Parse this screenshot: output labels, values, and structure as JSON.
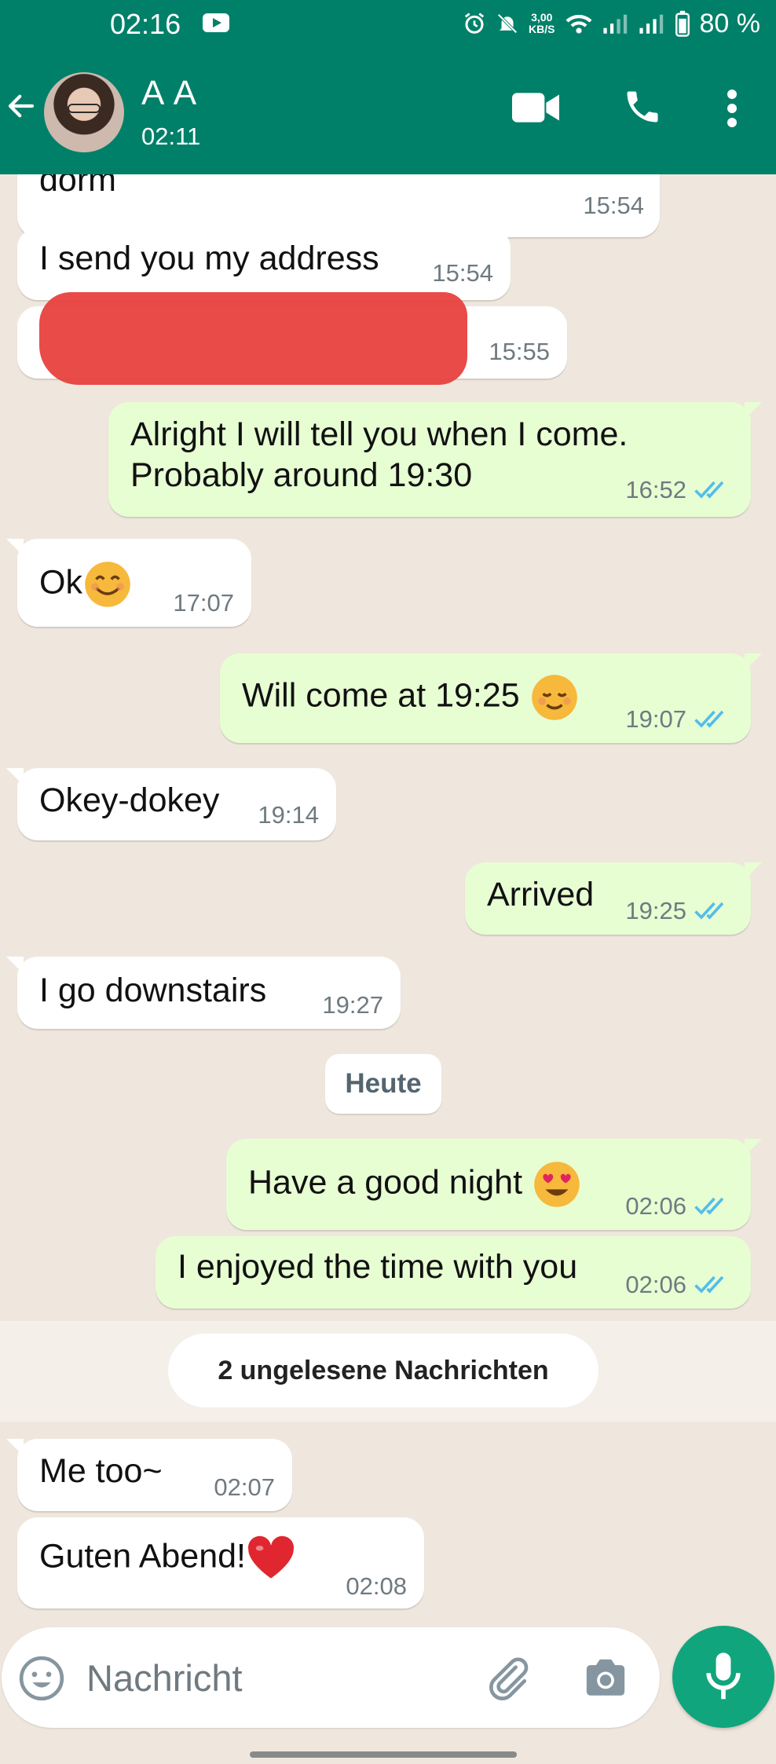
{
  "status_bar": {
    "time": "02:16",
    "net_speed_value": "3,00",
    "net_speed_unit": "KB/S",
    "battery": "80 %"
  },
  "header": {
    "contact_name": "A A",
    "subtitle": "02:11",
    "icons": [
      "back-arrow-icon",
      "video-call-icon",
      "voice-call-icon",
      "more-options-icon"
    ]
  },
  "messages": [
    {
      "dir": "in",
      "text": "dorm",
      "time": "15:54"
    },
    {
      "dir": "in",
      "text": "I send you my address",
      "time": "15:54"
    },
    {
      "dir": "in",
      "text": "",
      "time": "15:55"
    },
    {
      "dir": "out",
      "text_line1": "Alright I will tell you when I come.",
      "text_line2": "Probably around 19:30",
      "time": "16:52",
      "status": "read"
    },
    {
      "dir": "in",
      "text": "Ok",
      "emoji": "smiling-face-emoji",
      "time": "17:07"
    },
    {
      "dir": "out",
      "text": "Will come at 19:25",
      "emoji": "relieved-face-emoji",
      "time": "19:07",
      "status": "read"
    },
    {
      "dir": "in",
      "text": "Okey-dokey",
      "time": "19:14"
    },
    {
      "dir": "out",
      "text": "Arrived",
      "time": "19:25",
      "status": "read"
    },
    {
      "dir": "in",
      "text": "I go downstairs",
      "time": "19:27"
    },
    {
      "dir": "out",
      "text": "Have a good night",
      "emoji": "heart-eyes-emoji",
      "time": "02:06",
      "status": "read"
    },
    {
      "dir": "out",
      "text": "I enjoyed the time with you",
      "time": "02:06",
      "status": "read"
    },
    {
      "dir": "in",
      "text": "Me too~",
      "time": "02:07"
    },
    {
      "dir": "in",
      "text": "Guten Abend!",
      "emoji": "red-heart-emoji",
      "time": "02:08"
    }
  ],
  "date_separator": "Heute",
  "unread_banner": "2 ungelesene Nachrichten",
  "composer": {
    "placeholder": "Nachricht"
  },
  "colors": {
    "header": "#008069",
    "outgoing_bubble": "#e7fed3",
    "incoming_bubble": "#ffffff",
    "chat_bg": "#efe7dd",
    "read_ticks": "#53bdeb",
    "mic_button": "#11a57d",
    "redaction": "#e8413f"
  }
}
